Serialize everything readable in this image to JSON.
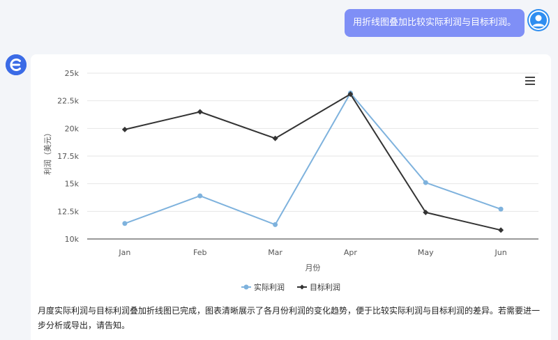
{
  "user_message": "用折线图叠加比较实际利润与目标利润。",
  "bot_avatar_icon": "e-logo-icon",
  "user_avatar_icon": "user-icon",
  "menu_icon": "hamburger-menu-icon",
  "chart_data": {
    "type": "line",
    "categories": [
      "Jan",
      "Feb",
      "Mar",
      "Apr",
      "May",
      "Jun"
    ],
    "series": [
      {
        "name": "实际利润",
        "values": [
          11400,
          13900,
          11300,
          23200,
          15100,
          12700
        ],
        "color": "#7eb2dd",
        "marker": "circle"
      },
      {
        "name": "目标利润",
        "values": [
          19900,
          21500,
          19100,
          23100,
          12400,
          10800
        ],
        "color": "#333333",
        "marker": "diamond"
      }
    ],
    "xlabel": "月份",
    "ylabel": "利润（美元）",
    "ylim": [
      10000,
      25000
    ],
    "y_ticks": [
      "10k",
      "12.5k",
      "15k",
      "17.5k",
      "20k",
      "22.5k",
      "25k"
    ],
    "grid": true,
    "legend": "bottom-center"
  },
  "summary": "月度实际利润与目标利润叠加折线图已完成，图表清晰展示了各月份利润的变化趋势，便于比较实际利润与目标利润的差异。若需要进一步分析或导出，请告知。"
}
